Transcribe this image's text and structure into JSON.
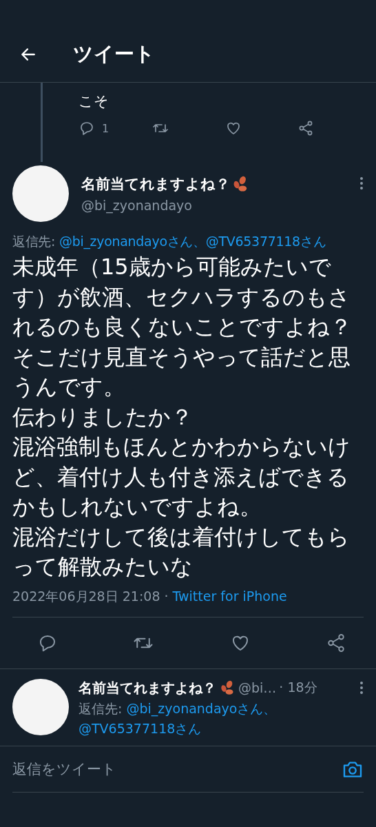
{
  "header": {
    "title": "ツイート"
  },
  "parent_tweet": {
    "text_tail": "こそ",
    "actions": [
      {
        "kind": "reply",
        "count": "1"
      },
      {
        "kind": "retweet"
      },
      {
        "kind": "like"
      },
      {
        "kind": "share"
      }
    ]
  },
  "main_tweet": {
    "name": "名前当てれますよね？",
    "handle": "@bi_zyonandayo",
    "reply_to": {
      "label": "返信先:",
      "mentions": [
        "@bi_zyonandayoさん、",
        "@TV65377118さん"
      ]
    },
    "body": [
      "未成年（15歳から可能みたいです）が飲酒、セクハラするのもされるのも良くないことですよね？そこだけ見直そうやって話だと思うんです。",
      "伝わりましたか？",
      "混浴強制もほんとかわからないけど、着付け人も付き添えばできるかもしれないですよね。",
      "混浴だけして後は着付けしてもらって解散みたいな"
    ],
    "timestamp": "2022年06月28日 21:08 ·",
    "source": "Twitter for iPhone",
    "actions": [
      {
        "kind": "reply"
      },
      {
        "kind": "retweet"
      },
      {
        "kind": "like"
      },
      {
        "kind": "share"
      }
    ]
  },
  "reply_tweet": {
    "name": "名前当てれますよね？",
    "handle": "@bi…",
    "time": "· 18分",
    "reply_to": {
      "label": "返信先:",
      "mentions": [
        "@bi_zyonandayoさん、",
        "@TV65377118さん"
      ]
    }
  },
  "compose": {
    "placeholder": "返信をツイート"
  }
}
